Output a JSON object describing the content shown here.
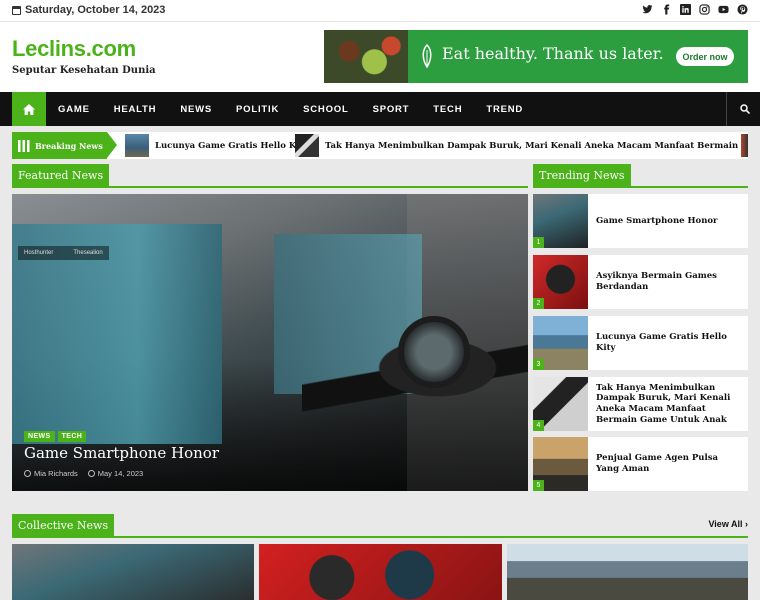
{
  "topbar": {
    "date": "Saturday, October 14, 2023",
    "social_icons": [
      "twitter-icon",
      "facebook-icon",
      "linkedin-icon",
      "instagram-icon",
      "youtube-icon",
      "pinterest-icon"
    ]
  },
  "header": {
    "site_name": "Leclins.com",
    "tagline": "Seputar Kesehatan Dunia",
    "ad": {
      "text": "Eat healthy. Thank us later.",
      "button": "Order now"
    }
  },
  "nav": {
    "items": [
      "GAME",
      "HEALTH",
      "NEWS",
      "POLITIK",
      "SCHOOL",
      "SPORT",
      "TECH",
      "TREND"
    ]
  },
  "breaking": {
    "label": "Breaking News",
    "items": [
      "Lucunya Game Gratis Hello Kity",
      "Tak Hanya Menimbulkan Dampak Buruk, Mari Kenali Aneka Macam Manfaat Bermain Game Untuk Anak"
    ]
  },
  "featured": {
    "section_title": "Featured News",
    "tags": [
      "NEWS",
      "TECH"
    ],
    "title": "Game Smartphone Honor",
    "author": "Mia Richards",
    "date": "May 14, 2023",
    "hud_left": "Hosthunter",
    "hud_right": "Thesealion"
  },
  "trending": {
    "section_title": "Trending News",
    "items": [
      {
        "num": "1",
        "title": "Game Smartphone Honor"
      },
      {
        "num": "2",
        "title": "Asyiknya Bermain Games Berdandan"
      },
      {
        "num": "3",
        "title": "Lucunya Game Gratis Hello Kity"
      },
      {
        "num": "4",
        "title": "Tak Hanya Menimbulkan Dampak Buruk, Mari Kenali Aneka Macam Manfaat Bermain Game Untuk Anak"
      },
      {
        "num": "5",
        "title": "Penjual Game Agen Pulsa Yang Aman"
      }
    ]
  },
  "collective": {
    "section_title": "Collective News",
    "view_all": "View All"
  },
  "colors": {
    "accent": "#4bb21a",
    "nav_bg": "#111111"
  }
}
